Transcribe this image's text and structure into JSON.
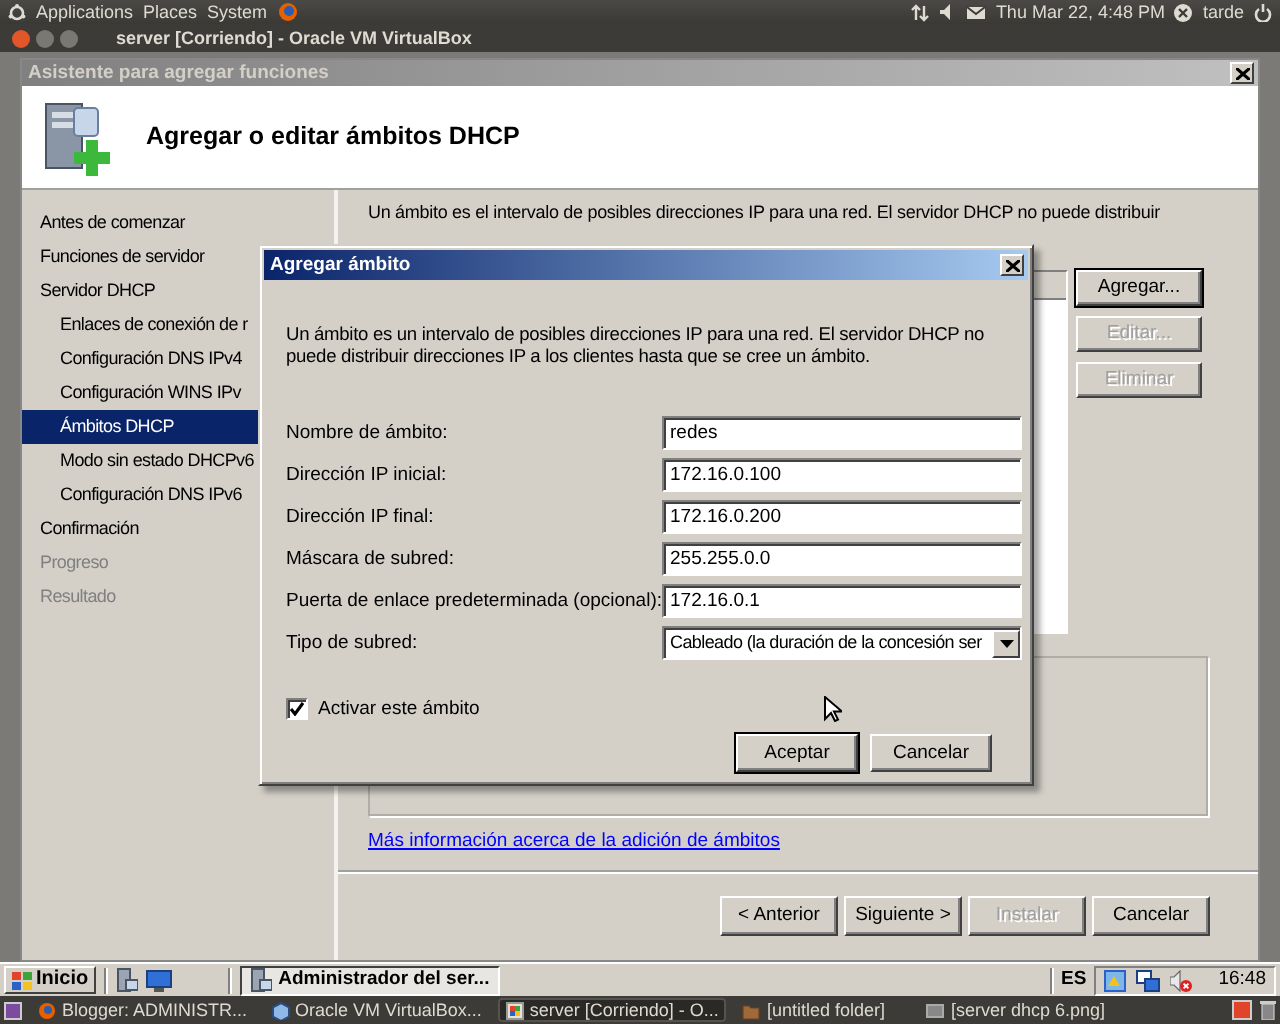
{
  "top_panel": {
    "menus": [
      "Applications",
      "Places",
      "System"
    ],
    "clock": "Thu Mar 22,  4:48 PM",
    "user": "tarde"
  },
  "vm_window": {
    "title": "server [Corriendo] - Oracle VM VirtualBox"
  },
  "wizard": {
    "title": "Asistente para agregar funciones",
    "heading": "Agregar o editar ámbitos DHCP",
    "steps": [
      {
        "label": "Antes de comenzar",
        "selected": false,
        "disabled": false
      },
      {
        "label": "Funciones de servidor",
        "selected": false,
        "disabled": false
      },
      {
        "label": "Servidor DHCP",
        "selected": false,
        "disabled": false,
        "children": [
          {
            "label": "Enlaces de conexión de r",
            "selected": false,
            "disabled": false
          },
          {
            "label": "Configuración DNS IPv4",
            "selected": false,
            "disabled": false
          },
          {
            "label": "Configuración WINS IPv",
            "selected": false,
            "disabled": false
          },
          {
            "label": "Ámbitos DHCP",
            "selected": true,
            "disabled": false
          },
          {
            "label": "Modo sin estado DHCPv6",
            "selected": false,
            "disabled": false
          },
          {
            "label": "Configuración DNS IPv6",
            "selected": false,
            "disabled": false
          }
        ]
      },
      {
        "label": "Confirmación",
        "selected": false,
        "disabled": false
      },
      {
        "label": "Progreso",
        "selected": false,
        "disabled": true
      },
      {
        "label": "Resultado",
        "selected": false,
        "disabled": true
      }
    ],
    "intro": "Un ámbito es el intervalo de posibles direcciones IP para una red. El servidor DHCP no puede distribuir",
    "side_buttons": [
      {
        "label": "Agregar...",
        "disabled": false,
        "default": true
      },
      {
        "label": "Editar...",
        "disabled": true,
        "default": false
      },
      {
        "label": "Eliminar",
        "disabled": true,
        "default": false
      }
    ],
    "link": "Más información acerca de la adición de ámbitos",
    "nav_buttons": [
      {
        "label": "< Anterior",
        "disabled": false
      },
      {
        "label": "Siguiente >",
        "disabled": false
      },
      {
        "label": "Instalar",
        "disabled": true
      },
      {
        "label": "Cancelar",
        "disabled": false
      }
    ]
  },
  "dialog": {
    "title": "Agregar ámbito",
    "description": "Un ámbito es un intervalo de posibles direcciones IP para una red. El servidor DHCP no puede distribuir direcciones IP a los clientes hasta que se cree un ámbito.",
    "fields": [
      {
        "kind": "text",
        "label": "Nombre de ámbito:",
        "value": "redes"
      },
      {
        "kind": "text",
        "label": "Dirección IP inicial:",
        "value": "172.16.0.100"
      },
      {
        "kind": "text",
        "label": "Dirección IP final:",
        "value": "172.16.0.200"
      },
      {
        "kind": "text",
        "label": "Máscara de subred:",
        "value": "255.255.0.0"
      },
      {
        "kind": "text",
        "label": "Puerta de enlace predeterminada (opcional):",
        "value": "172.16.0.1"
      },
      {
        "kind": "select",
        "label": "Tipo de subred:",
        "value": "Cableado (la duración de la concesión ser"
      }
    ],
    "activate": {
      "label": "Activar este ámbito",
      "checked": true
    },
    "buttons": [
      {
        "label": "Aceptar",
        "default": true
      },
      {
        "label": "Cancelar",
        "default": false
      }
    ]
  },
  "taskbar": {
    "start": "Inicio",
    "tasks": [
      {
        "label": "Administrador del ser...",
        "selected": true
      }
    ],
    "language": "ES",
    "clock": "16:48"
  },
  "bottom_panel": {
    "tasks": [
      {
        "kind": "browser",
        "label": "Blogger: ADMINISTR...",
        "selected": false
      },
      {
        "kind": "virtualbox",
        "label": "Oracle VM VirtualBox...",
        "selected": false
      },
      {
        "kind": "vm",
        "label": "server [Corriendo] - O...",
        "selected": true
      },
      {
        "kind": "folder",
        "label": "[untitled folder]",
        "selected": false
      },
      {
        "kind": "image",
        "label": "[server dhcp 6.png]",
        "selected": false
      }
    ]
  }
}
